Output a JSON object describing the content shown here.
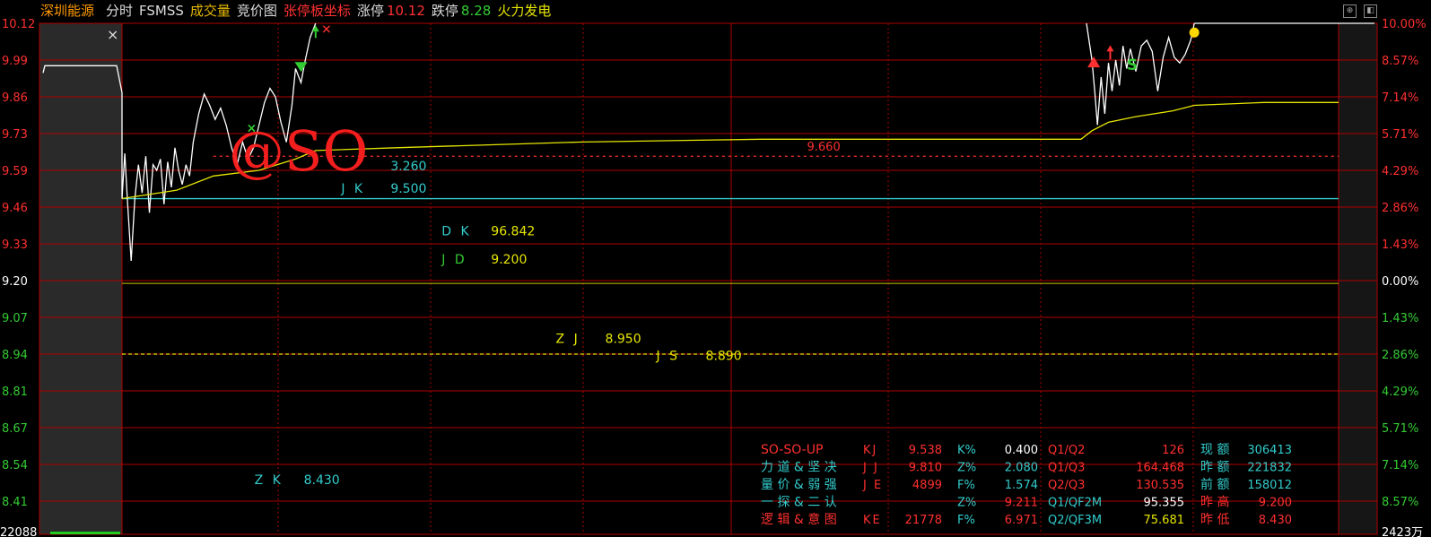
{
  "header": {
    "stock_name": "深圳能源",
    "mode": "分时",
    "indicator": "FSMSS",
    "volume_label": "成交量",
    "auction_label": "竞价图",
    "limit_coord_label": "张停板坐标",
    "limit_up_label": "涨停",
    "limit_up_value": "10.12",
    "limit_down_label": "跌停",
    "limit_down_value": "8.28",
    "sector": "火力发电"
  },
  "colors": {
    "grid": "#b00000",
    "price_line": "#ffffff",
    "avg_line": "#e6e600",
    "cyan": "#33cccc",
    "up": "#ff3030",
    "down": "#33cc33",
    "yellow": "#e6e600"
  },
  "chart_data": {
    "type": "line",
    "y_ticks_left": [
      "10.12",
      "9.99",
      "9.86",
      "9.73",
      "9.59",
      "9.46",
      "9.33",
      "9.20",
      "9.07",
      "8.94",
      "8.81",
      "8.67",
      "8.54",
      "8.41"
    ],
    "y_ticks_right": [
      "10.00%",
      "8.57%",
      "7.14%",
      "5.71%",
      "4.29%",
      "2.86%",
      "1.43%",
      "0.00%",
      "1.43%",
      "2.86%",
      "4.29%",
      "5.71%",
      "7.14%",
      "8.57%"
    ],
    "ylim": [
      8.35,
      10.12
    ],
    "prev_close": 9.2,
    "bottom_left_label": "22088",
    "bottom_right_label": "2423万",
    "price_series": [
      [
        0,
        9.5
      ],
      [
        3,
        9.66
      ],
      [
        6,
        9.49
      ],
      [
        10,
        9.28
      ],
      [
        14,
        9.5
      ],
      [
        18,
        9.62
      ],
      [
        22,
        9.52
      ],
      [
        26,
        9.65
      ],
      [
        30,
        9.45
      ],
      [
        34,
        9.62
      ],
      [
        38,
        9.6
      ],
      [
        42,
        9.64
      ],
      [
        46,
        9.48
      ],
      [
        50,
        9.63
      ],
      [
        54,
        9.54
      ],
      [
        58,
        9.68
      ],
      [
        62,
        9.6
      ],
      [
        66,
        9.55
      ],
      [
        70,
        9.62
      ],
      [
        74,
        9.58
      ],
      [
        78,
        9.7
      ],
      [
        84,
        9.8
      ],
      [
        90,
        9.87
      ],
      [
        96,
        9.83
      ],
      [
        102,
        9.78
      ],
      [
        108,
        9.82
      ],
      [
        114,
        9.76
      ],
      [
        120,
        9.68
      ],
      [
        126,
        9.62
      ],
      [
        132,
        9.7
      ],
      [
        138,
        9.64
      ],
      [
        144,
        9.68
      ],
      [
        150,
        9.76
      ],
      [
        156,
        9.84
      ],
      [
        162,
        9.89
      ],
      [
        168,
        9.86
      ],
      [
        174,
        9.77
      ],
      [
        180,
        9.7
      ],
      [
        186,
        9.83
      ],
      [
        190,
        9.96
      ],
      [
        196,
        9.91
      ],
      [
        200,
        9.98
      ],
      [
        206,
        10.07
      ],
      [
        212,
        10.12
      ],
      [
        1056,
        10.12
      ],
      [
        1062,
        9.99
      ],
      [
        1065,
        9.88
      ],
      [
        1068,
        9.76
      ],
      [
        1072,
        9.93
      ],
      [
        1076,
        9.8
      ],
      [
        1080,
        9.98
      ],
      [
        1084,
        9.88
      ],
      [
        1088,
        9.99
      ],
      [
        1092,
        9.9
      ],
      [
        1096,
        10.04
      ],
      [
        1100,
        9.96
      ],
      [
        1104,
        10.03
      ],
      [
        1110,
        9.95
      ],
      [
        1116,
        10.04
      ],
      [
        1122,
        10.06
      ],
      [
        1128,
        10.02
      ],
      [
        1134,
        9.88
      ],
      [
        1140,
        10.0
      ],
      [
        1146,
        10.07
      ],
      [
        1152,
        10.0
      ],
      [
        1158,
        9.98
      ],
      [
        1164,
        10.01
      ],
      [
        1170,
        10.06
      ],
      [
        1174,
        10.12
      ],
      [
        1332,
        10.12
      ]
    ],
    "avg_series": [
      [
        0,
        9.5
      ],
      [
        20,
        9.51
      ],
      [
        60,
        9.53
      ],
      [
        100,
        9.58
      ],
      [
        150,
        9.6
      ],
      [
        190,
        9.64
      ],
      [
        212,
        9.67
      ],
      [
        300,
        9.68
      ],
      [
        500,
        9.7
      ],
      [
        700,
        9.71
      ],
      [
        900,
        9.71
      ],
      [
        1050,
        9.71
      ],
      [
        1062,
        9.74
      ],
      [
        1080,
        9.77
      ],
      [
        1110,
        9.79
      ],
      [
        1150,
        9.81
      ],
      [
        1174,
        9.83
      ],
      [
        1250,
        9.84
      ],
      [
        1332,
        9.84
      ]
    ],
    "pre_market_value": 9.97,
    "level_lines": [
      {
        "name": "JK",
        "value": 9.5,
        "color": "#33cccc",
        "style": "solid",
        "x_start": 0
      },
      {
        "name": "ZJ",
        "value": 8.95,
        "color": "#e6e600",
        "style": "dashed",
        "x_start": 0
      },
      {
        "name": "red-dash",
        "value": 9.65,
        "color": "#ff3030",
        "style": "dashed",
        "x_start": 100
      }
    ],
    "annotations": [
      {
        "id": "jk",
        "texts": [
          "J K",
          "9.500"
        ],
        "color": "#33cccc",
        "price": 9.52,
        "minute": 240,
        "top_label": "3.260",
        "top_price": 9.6
      },
      {
        "id": "dk",
        "texts": [
          "D K",
          "96.842"
        ],
        "colors": [
          "#33cccc",
          "#e6e600"
        ],
        "price": 9.37,
        "minute": 350
      },
      {
        "id": "jd",
        "texts": [
          "J D",
          "9.200"
        ],
        "colors": [
          "#33cc33",
          "#e6e600"
        ],
        "price": 9.27,
        "minute": 350
      },
      {
        "id": "zj",
        "texts": [
          "Z J",
          "8.950"
        ],
        "color": "#e6e600",
        "price": 8.99,
        "minute": 475
      },
      {
        "id": "js",
        "texts": [
          "J S",
          "8.890"
        ],
        "color": "#e6e600",
        "price": 8.93,
        "minute": 585
      },
      {
        "id": "ref",
        "texts": [
          "9.660"
        ],
        "color": "#ff3030",
        "price": 9.67,
        "minute": 750
      },
      {
        "id": "zk",
        "texts": [
          "Z K",
          "8.430"
        ],
        "color": "#33cccc",
        "price": 8.49,
        "minute": 145
      }
    ],
    "watermark": "@SO",
    "markers": [
      {
        "type": "x-green",
        "minute": 141,
        "price": 9.75
      },
      {
        "type": "tri-down-green",
        "minute": 196,
        "price": 9.97
      },
      {
        "type": "arrow-up-green",
        "minute": 212,
        "price": 10.1
      },
      {
        "type": "x-red",
        "minute": 224,
        "price": 10.1
      },
      {
        "type": "tri-up-red",
        "minute": 1064,
        "price": 9.98
      },
      {
        "type": "arrow-up-red",
        "minute": 1082,
        "price": 10.03
      },
      {
        "type": "s-green",
        "minute": 1100,
        "price": 9.98
      },
      {
        "type": "dot-yellow",
        "minute": 1174,
        "price": 10.1
      }
    ]
  },
  "info_table": {
    "rows": [
      {
        "name": "SO-SO-UP",
        "name_color": "#ff3030",
        "k1": "KJ",
        "v1": "9.538",
        "k2": "K%",
        "v2": "0.400",
        "v2_color": "#ffffff",
        "k3": "Q1/Q2",
        "v3": "126",
        "v3_color": "#ff3030",
        "k4": "现 额",
        "v4": "306413"
      },
      {
        "name": "力 道 & 坚 决",
        "name_color": "#33cccc",
        "k1": "J J",
        "v1": "9.810",
        "k2": "Z%",
        "v2": "2.080",
        "v2_color": "#33cccc",
        "k3": "Q1/Q3",
        "v3": "164.468",
        "v3_color": "#ff3030",
        "k4": "昨 额",
        "v4": "221832"
      },
      {
        "name": "量 价 & 弱 强",
        "name_color": "#33cccc",
        "k1": "J E",
        "v1": "4899",
        "k2": "F%",
        "v2": "1.574",
        "v2_color": "#33cccc",
        "k3": "Q2/Q3",
        "v3": "130.535",
        "v3_color": "#ff3030",
        "k4": "前 额",
        "v4": "158012"
      },
      {
        "name": "一 探 & 二 认",
        "name_color": "#33cccc",
        "k1": "",
        "v1": "",
        "k2": "Z%",
        "v2": "9.211",
        "v2_color": "#ff3030",
        "k3": "Q1/QF2M",
        "v3": "95.355",
        "v3_color": "#ffffff",
        "k4": "昨 高",
        "v4": "9.200"
      },
      {
        "name": "逻 辑 & 意 图",
        "name_color": "#ff3030",
        "k1": "KE",
        "v1": "21778",
        "k2": "F%",
        "v2": "6.971",
        "v2_color": "#ff3030",
        "k3": "Q2/QF3M",
        "v3": "75.681",
        "v3_color": "#e6e600",
        "k4": "昨 低",
        "v4": "8.430"
      }
    ]
  }
}
